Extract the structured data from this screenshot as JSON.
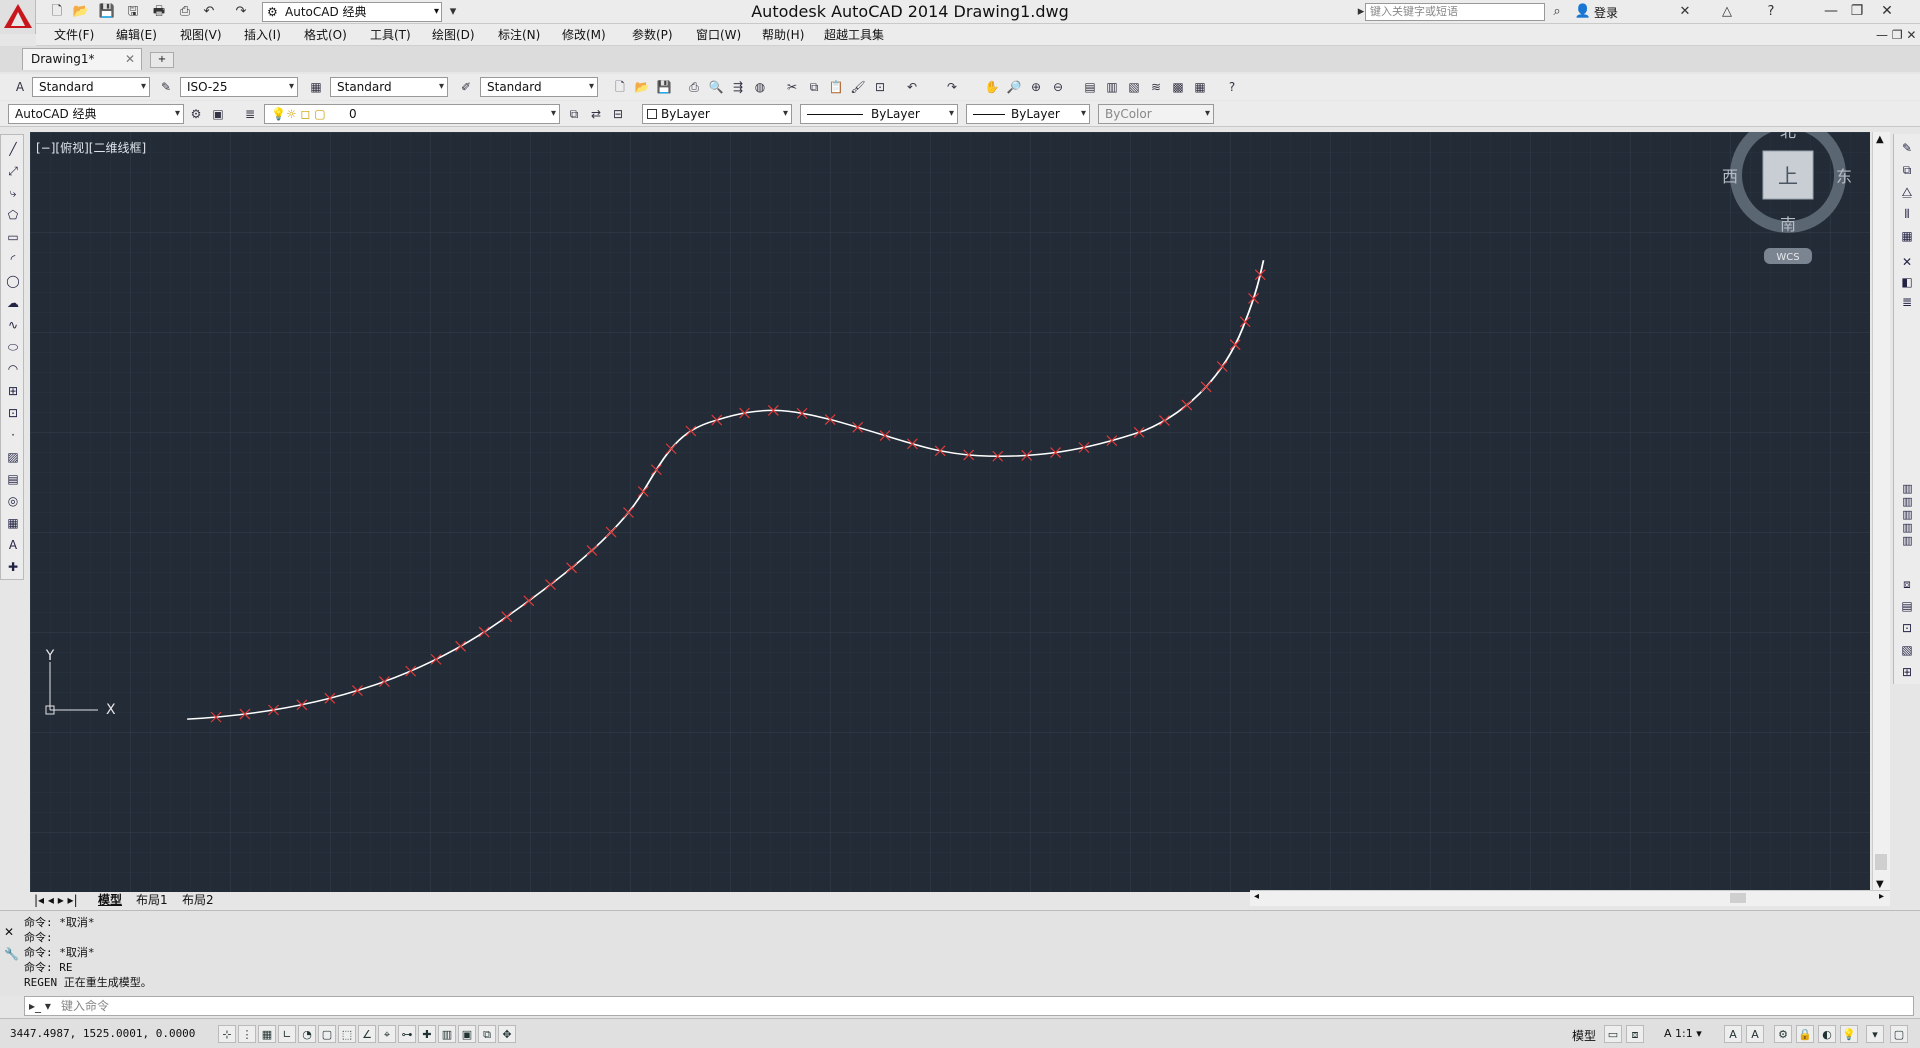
{
  "app": {
    "title": "Autodesk AutoCAD 2014    Drawing1.dwg",
    "workspace": "AutoCAD 经典",
    "search_placeholder": "键入关键字或短语",
    "login": "登录"
  },
  "menus": [
    "文件(F)",
    "编辑(E)",
    "视图(V)",
    "插入(I)",
    "格式(O)",
    "工具(T)",
    "绘图(D)",
    "标注(N)",
    "修改(M)",
    "参数(P)",
    "窗口(W)",
    "帮助(H)",
    "超越工具集"
  ],
  "doc_tab": "Drawing1*",
  "styles": {
    "text_style": "Standard",
    "dim_style": "ISO-25",
    "table_style": "Standard",
    "mleader_style": "Standard"
  },
  "layers": {
    "workspace": "AutoCAD 经典",
    "layer": "0",
    "color": "ByLayer",
    "linetype": "ByLayer",
    "lineweight": "ByLayer",
    "plotstyle": "ByColor"
  },
  "viewport": {
    "label": "[−][俯视][二维线框]",
    "viewcube": {
      "top": "上",
      "north": "北",
      "south": "南",
      "west": "西",
      "east": "东",
      "wcs": "WCS"
    },
    "ucs": {
      "x": "X",
      "y": "Y"
    }
  },
  "layout_tabs": [
    "模型",
    "布局1",
    "布局2"
  ],
  "command_history": [
    "命令: *取消*",
    "命令:",
    "命令: *取消*",
    "命令: RE",
    "REGEN 正在重生成模型。"
  ],
  "command_placeholder": "键入命令",
  "coords": "3447.4987, 1525.0001, 0.0000",
  "status": {
    "model": "模型",
    "scale": "1:1"
  },
  "colors": {
    "canvas": "#222b36",
    "curve": "#ffffff",
    "marker": "#e23a3a"
  }
}
